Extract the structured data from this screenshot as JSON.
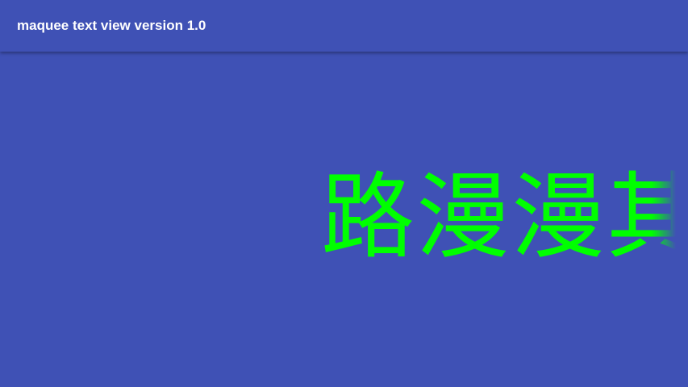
{
  "toolbar": {
    "title": "maquee text view version 1.0"
  },
  "marquee": {
    "text": "路漫漫其",
    "color": "#00ff00"
  },
  "colors": {
    "primary": "#3f51b5",
    "title_text": "#ffffff"
  }
}
